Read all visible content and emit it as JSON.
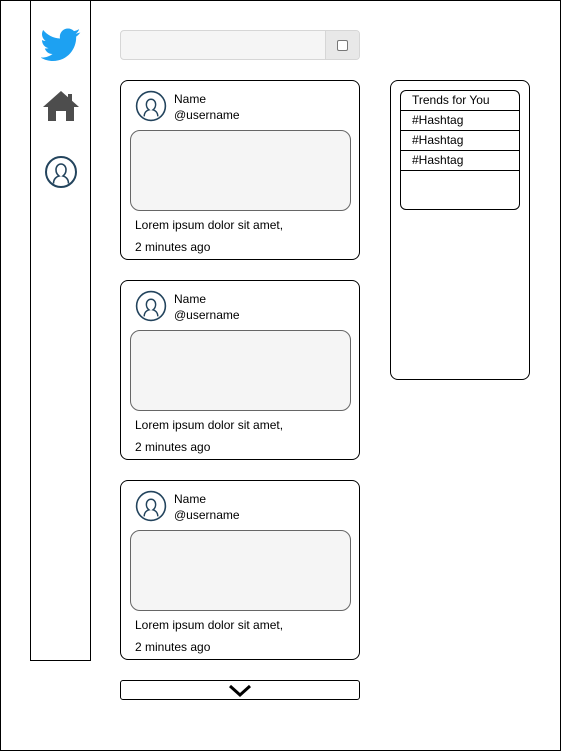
{
  "colors": {
    "brand": "#1da1f2",
    "icon": "#4d4d4d",
    "avatar_stroke": "#23445d"
  },
  "sidebar": {
    "items": [
      {
        "icon": "twitter-bird-icon"
      },
      {
        "icon": "home-icon"
      },
      {
        "icon": "profile-icon"
      }
    ]
  },
  "search": {
    "value": "",
    "placeholder": ""
  },
  "feed": {
    "posts": [
      {
        "name": "Name",
        "handle": "@username",
        "text": "Lorem ipsum dolor sit amet,",
        "time": "2 minutes ago"
      },
      {
        "name": "Name",
        "handle": "@username",
        "text": "Lorem ipsum dolor sit amet,",
        "time": "2 minutes ago"
      },
      {
        "name": "Name",
        "handle": "@username",
        "text": "Lorem ipsum dolor sit amet,",
        "time": "2 minutes ago"
      }
    ],
    "load_more_icon": "chevron-down-icon"
  },
  "trends": {
    "title": "Trends for You",
    "items": [
      "#Hashtag",
      "#Hashtag",
      "#Hashtag"
    ]
  }
}
